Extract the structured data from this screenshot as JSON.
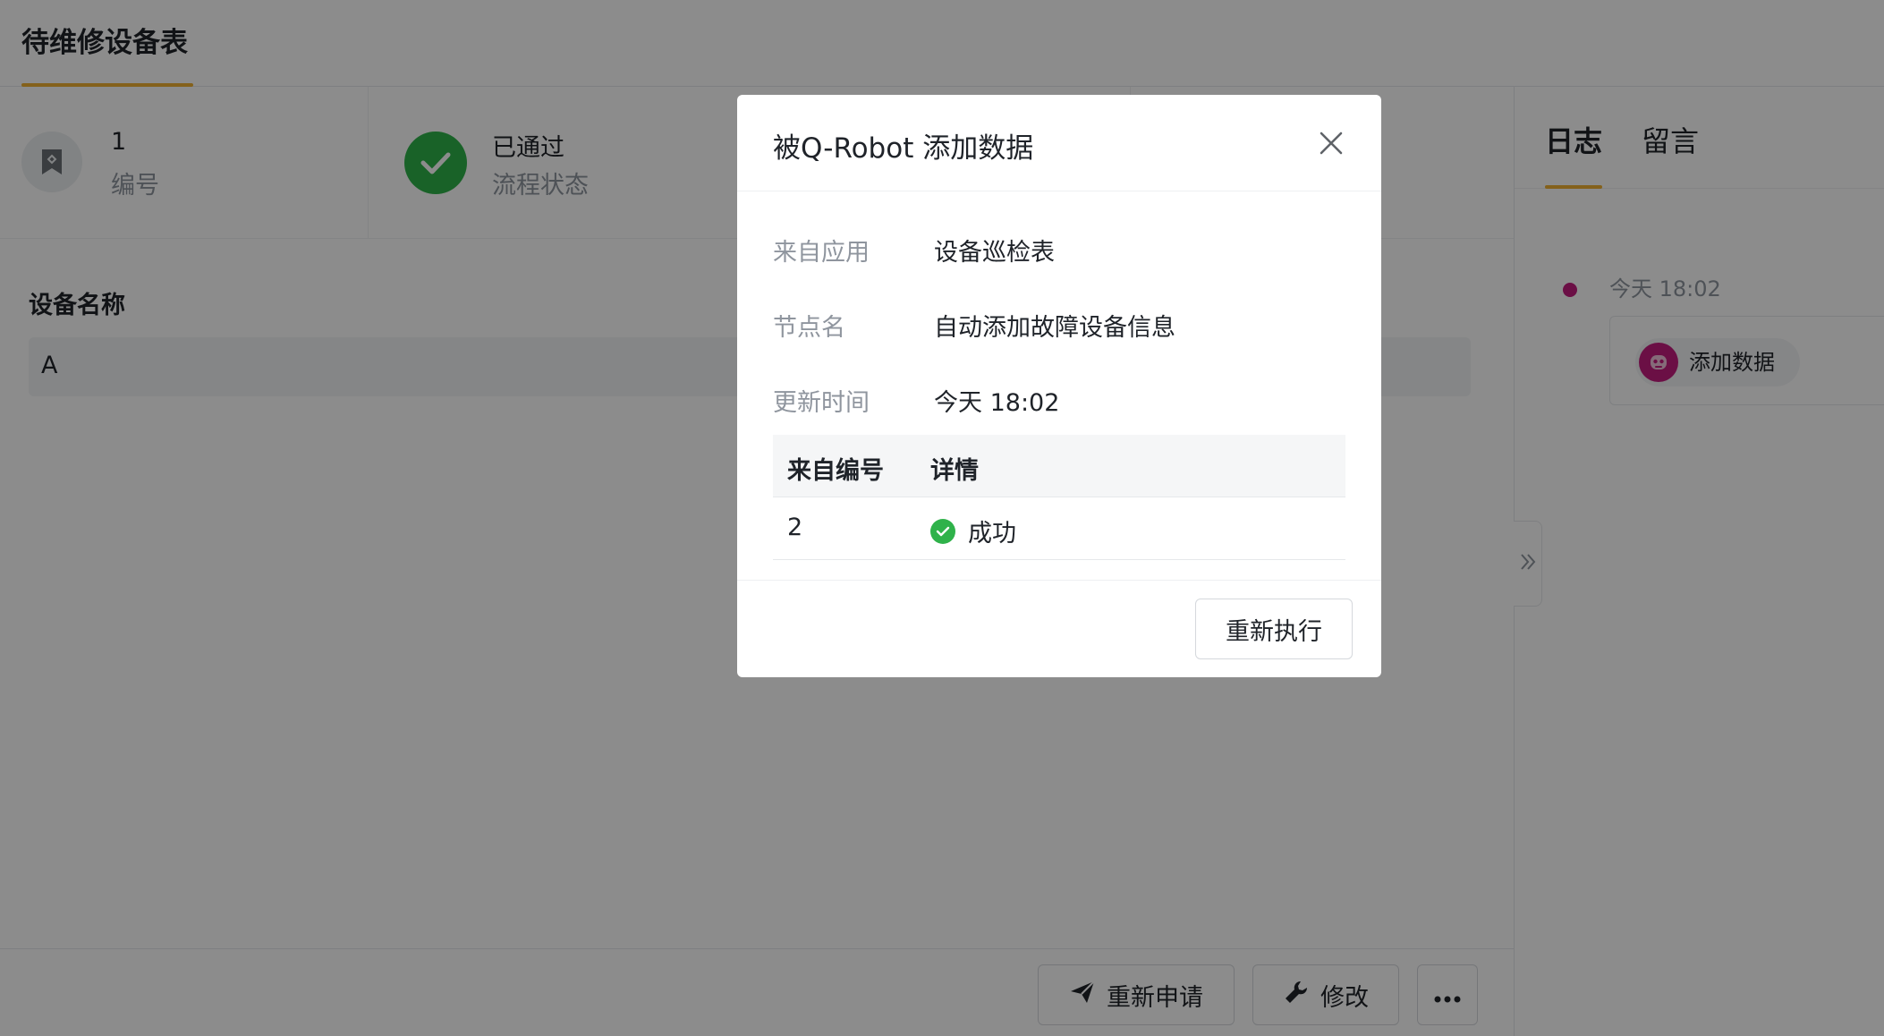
{
  "header": {
    "title": "待维修设备表"
  },
  "record_info": {
    "number_value": "1",
    "number_label": "编号",
    "status_value": "已通过",
    "status_label": "流程状态"
  },
  "fields": [
    {
      "label": "设备名称",
      "value": "A"
    }
  ],
  "actions": {
    "reapply_label": "重新申请",
    "modify_label": "修改"
  },
  "right_panel": {
    "tabs": [
      {
        "label": "日志",
        "active": true
      },
      {
        "label": "留言",
        "active": false
      }
    ],
    "timeline": [
      {
        "time": "今天 18:02",
        "action": "添加数据"
      }
    ]
  },
  "modal": {
    "title": "被Q-Robot 添加数据",
    "rows": [
      {
        "label": "来自应用",
        "value": "设备巡检表"
      },
      {
        "label": "节点名",
        "value": "自动添加故障设备信息"
      },
      {
        "label": "更新时间",
        "value": "今天 18:02"
      }
    ],
    "table": {
      "headers": [
        "来自编号",
        "详情"
      ],
      "rows": [
        {
          "source_number": "2",
          "detail": "成功"
        }
      ]
    },
    "rerun_label": "重新执行"
  },
  "colors": {
    "accent": "#f0b132",
    "success": "#2fb24a",
    "robot": "#c41d7f",
    "overlay": "rgba(0,0,0,0.45)"
  },
  "icons": {
    "number": "bookmark-icon",
    "status": "check-circle-icon",
    "reapply": "send-icon",
    "modify": "wrench-icon",
    "more": "more-icon",
    "close": "close-icon",
    "collapse": "double-chevron-right-icon",
    "robot": "robot-icon"
  }
}
